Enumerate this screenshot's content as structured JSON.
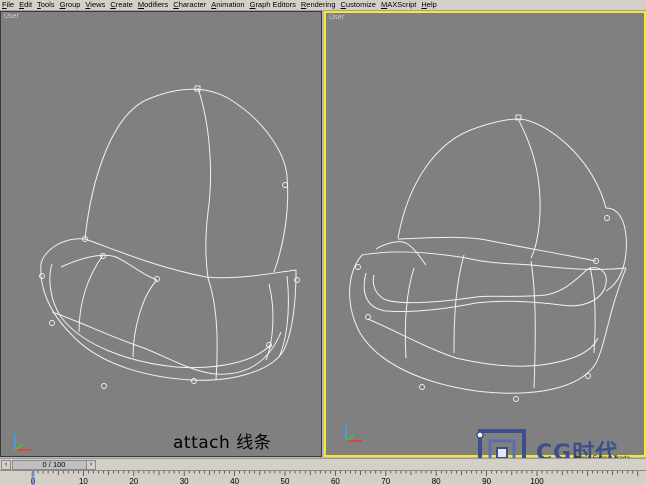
{
  "menubar": {
    "items": [
      "File",
      "Edit",
      "Tools",
      "Group",
      "Views",
      "Create",
      "Modifiers",
      "Character",
      "Animation",
      "Graph Editors",
      "Rendering",
      "Customize",
      "MAXScript",
      "Help"
    ]
  },
  "viewports": {
    "left_label": "User",
    "right_label": "User"
  },
  "caption": {
    "text": "attach 线条"
  },
  "watermark": {
    "brand": "CG时代",
    "subtitle": "Rapid Expert Trade"
  },
  "timeslider": {
    "frame_readout": "0 / 100",
    "prev_icon": "chevron-left-icon",
    "next_icon": "chevron-right-icon"
  },
  "ruler": {
    "ticks": [
      "0",
      "10",
      "20",
      "30",
      "40",
      "50",
      "60",
      "70",
      "80",
      "90",
      "100"
    ]
  },
  "colors": {
    "viewport_bg": "#808080",
    "active_border": "#f4ea2a",
    "wire": "#f2f2f2",
    "ui_gray": "#d4d0c8"
  }
}
